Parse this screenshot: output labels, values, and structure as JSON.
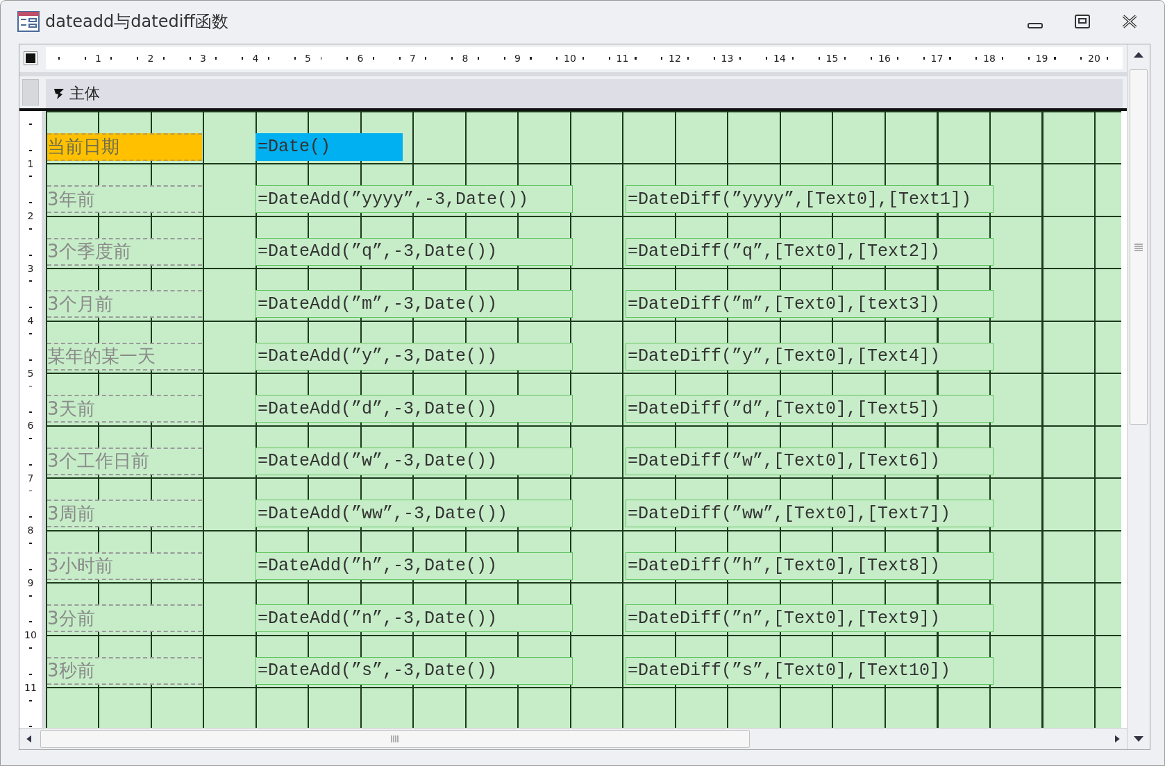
{
  "window": {
    "title": "dateadd与datediff函数"
  },
  "ruler": {
    "horizontal": [
      "1",
      "2",
      "3",
      "4",
      "5",
      "6",
      "7",
      "8",
      "9",
      "10",
      "11",
      "12",
      "13",
      "14",
      "15",
      "16",
      "17",
      "18",
      "19",
      "20"
    ],
    "vertical": [
      "1",
      "2",
      "3",
      "4",
      "5",
      "6",
      "7",
      "8",
      "9",
      "10",
      "11"
    ]
  },
  "section": {
    "title": "主体"
  },
  "rows": [
    {
      "kind": "highlighted",
      "label": "当前日期",
      "dateadd": "=Date()"
    },
    {
      "kind": "plain",
      "label": "3年前",
      "dateadd": "=DateAdd(”yyyy”,-3,Date())",
      "datediff": "=DateDiff(”yyyy”,[Text0],[Text1])"
    },
    {
      "kind": "plain",
      "label": "3个季度前",
      "dateadd": "=DateAdd(”q”,-3,Date())",
      "datediff": "=DateDiff(”q”,[Text0],[Text2])"
    },
    {
      "kind": "plain",
      "label": "3个月前",
      "dateadd": "=DateAdd(”m”,-3,Date())",
      "datediff": "=DateDiff(”m”,[Text0],[text3])"
    },
    {
      "kind": "plain",
      "label": "某年的某一天",
      "dateadd": "=DateAdd(”y”,-3,Date())",
      "datediff": "=DateDiff(”y”,[Text0],[Text4])"
    },
    {
      "kind": "plain",
      "label": "3天前",
      "dateadd": "=DateAdd(”d”,-3,Date())",
      "datediff": "=DateDiff(”d”,[Text0],[Text5])"
    },
    {
      "kind": "plain",
      "label": "3个工作日前",
      "dateadd": "=DateAdd(”w”,-3,Date())",
      "datediff": "=DateDiff(”w”,[Text0],[Text6])"
    },
    {
      "kind": "plain",
      "label": "3周前",
      "dateadd": "=DateAdd(”ww”,-3,Date())",
      "datediff": "=DateDiff(”ww”,[Text0],[Text7])"
    },
    {
      "kind": "plain",
      "label": "3小时前",
      "dateadd": "=DateAdd(”h”,-3,Date())",
      "datediff": "=DateDiff(”h”,[Text0],[Text8])"
    },
    {
      "kind": "plain",
      "label": "3分前",
      "dateadd": "=DateAdd(”n”,-3,Date())",
      "datediff": "=DateDiff(”n”,[Text0],[Text9])"
    },
    {
      "kind": "plain",
      "label": "3秒前",
      "dateadd": "=DateAdd(”s”,-3,Date())",
      "datediff": "=DateDiff(”s”,[Text0],[Text10])"
    }
  ]
}
